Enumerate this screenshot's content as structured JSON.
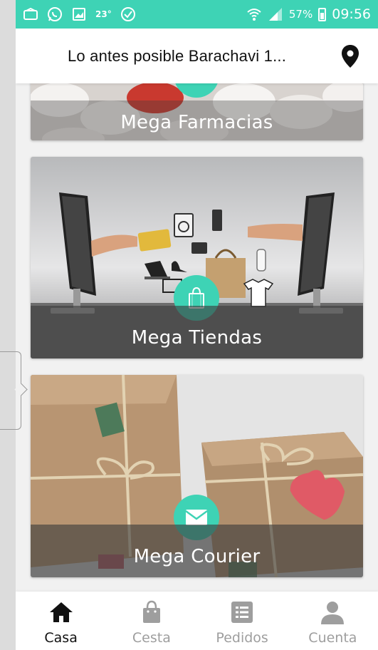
{
  "status_bar": {
    "temperature": "23°",
    "battery": "57%",
    "time": "09:56",
    "icons": [
      "image-icon",
      "whatsapp-icon",
      "gallery-icon",
      "check-circle-icon",
      "wifi-icon",
      "signal-icon",
      "battery-icon"
    ]
  },
  "header": {
    "title": "Lo antes posible Barachavi 1...",
    "icon": "location-pin-icon"
  },
  "cards": [
    {
      "label": "Mega Farmacias",
      "badge_icon": "medical-cross-icon"
    },
    {
      "label": "Mega Tiendas",
      "badge_icon": "shopping-bag-icon"
    },
    {
      "label": "Mega Courier",
      "badge_icon": "envelope-icon"
    }
  ],
  "bottom_nav": {
    "active": "Casa",
    "items": [
      {
        "label": "Casa",
        "icon": "home-icon"
      },
      {
        "label": "Cesta",
        "icon": "basket-icon"
      },
      {
        "label": "Pedidos",
        "icon": "list-icon"
      },
      {
        "label": "Cuenta",
        "icon": "person-icon"
      }
    ]
  },
  "colors": {
    "accent": "#3ed3b5",
    "active_nav": "#111111",
    "inactive_nav": "#9e9e9e"
  }
}
